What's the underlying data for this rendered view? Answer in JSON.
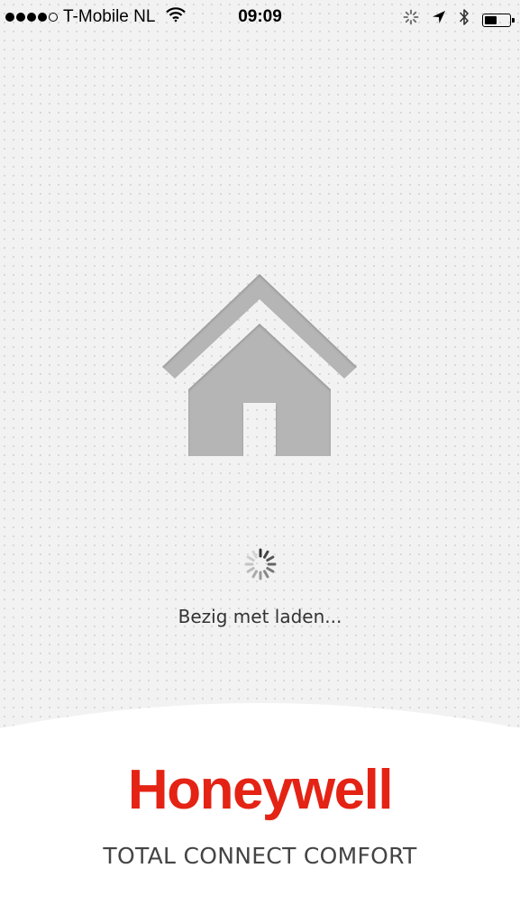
{
  "status_bar": {
    "carrier": "T-Mobile NL",
    "time": "09:09",
    "signal_bars_filled": 4,
    "signal_bars_total": 5,
    "battery_level": 0.5,
    "icons": [
      "wifi-icon",
      "activity-icon",
      "location-arrow-icon",
      "bluetooth-icon",
      "battery-icon"
    ]
  },
  "main": {
    "illustration": "house-icon",
    "loading_text": "Bezig met laden..."
  },
  "branding": {
    "logo_text": "Honeywell",
    "tagline": "TOTAL CONNECT COMFORT",
    "logo_color": "#e42314"
  },
  "colors": {
    "background": "#f2f2f2",
    "house": "#b5b5b5",
    "footer": "#ffffff"
  }
}
